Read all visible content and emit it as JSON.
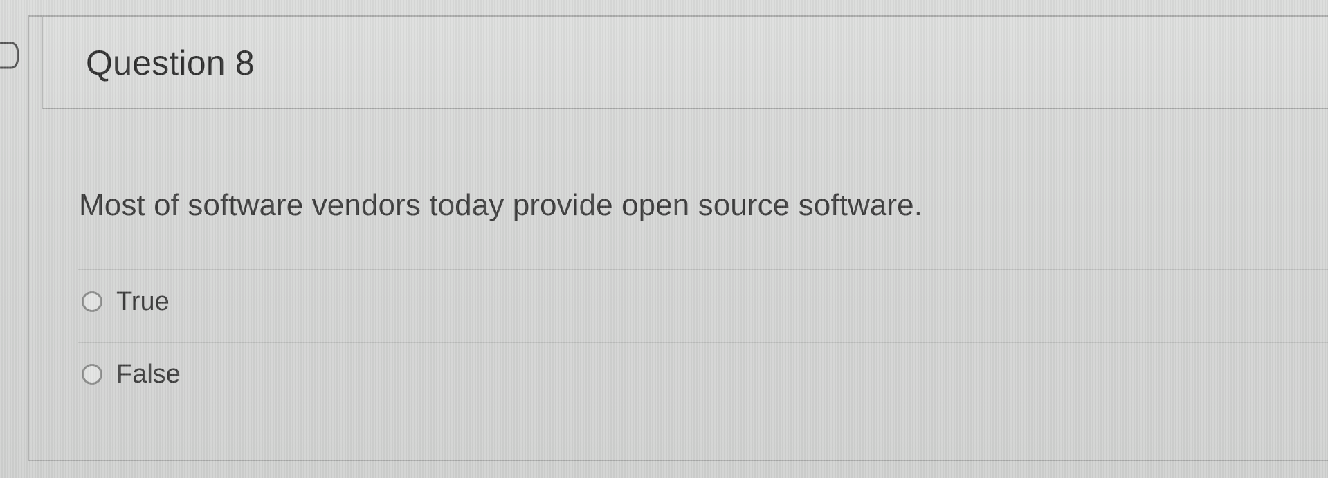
{
  "question": {
    "title": "Question 8",
    "text": "Most of software vendors today provide open source software.",
    "options": [
      {
        "label": "True",
        "selected": false
      },
      {
        "label": "False",
        "selected": false
      }
    ]
  },
  "icons": {
    "collapse_toggle": "chevron-right-icon"
  },
  "colors": {
    "background": "#d6d7d6",
    "header_background": "#dadbda",
    "border": "#a9aaa9",
    "text": "#3a3a3a"
  }
}
